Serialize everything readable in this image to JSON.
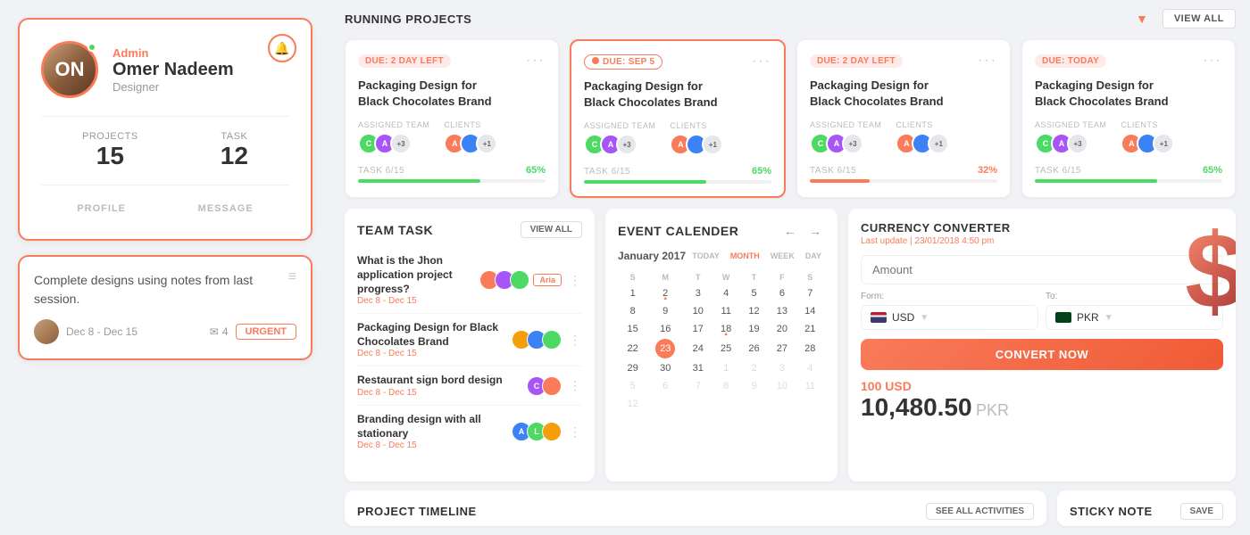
{
  "sidebar": {
    "profile": {
      "role": "Admin",
      "name": "Omer Nadeem",
      "title": "Designer",
      "projects_label": "Projects",
      "projects_count": "15",
      "task_label": "Task",
      "task_count": "12",
      "profile_btn": "PROFILE",
      "message_btn": "MESSAGE"
    },
    "task_card": {
      "text": "Complete designs using notes from last session.",
      "date": "Dec 8 - Dec 15",
      "messages": "4",
      "urgent_label": "URGENT"
    }
  },
  "running_projects": {
    "title": "RUNNING PROJECTS",
    "view_all": "VIEW ALL",
    "cards": [
      {
        "due": "DUE: 2 DAY LEFT",
        "due_type": "left",
        "name": "Packaging Design for Black Chocolates Brand",
        "task_label": "TASK 6/15",
        "progress": 65,
        "progress_type": "green",
        "active": false
      },
      {
        "due": "DUE: SEP 5",
        "due_type": "sep",
        "name": "Packaging Design for Black Chocolates Brand",
        "task_label": "TASK 6/15",
        "progress": 65,
        "progress_type": "green",
        "active": true
      },
      {
        "due": "DUE: 2 DAY LEFT",
        "due_type": "left",
        "name": "Packaging Design for Black Chocolates Brand",
        "task_label": "TASK 6/15",
        "progress": 32,
        "progress_type": "orange",
        "active": false
      },
      {
        "due": "DUE: TODAY",
        "due_type": "today",
        "name": "Packaging Design for Black Chocolates Brand",
        "task_label": "TASK 6/15",
        "progress": 65,
        "progress_type": "green",
        "active": false
      }
    ]
  },
  "team_task": {
    "title": "TEAM TASK",
    "view_all": "VIEW ALL",
    "tasks": [
      {
        "name": "What is the Jhon application project progress?",
        "date": "Dec 8 - Dec 15",
        "has_aria": true
      },
      {
        "name": "Packaging Design for Black Chocolates Brand",
        "date": "Dec 8 - Dec 15",
        "has_aria": false
      },
      {
        "name": "Restaurant sign bord design",
        "date": "Dec 8 - Dec 15",
        "has_aria": false
      },
      {
        "name": "Branding design with all stationary",
        "date": "Dec 8 - Dec 15",
        "has_aria": false
      }
    ]
  },
  "event_calendar": {
    "title": "EVENT CALENDER",
    "month_year": "January 2017",
    "today_btn": "TODAY",
    "month_btn": "MONTH",
    "week_btn": "WEEK",
    "day_btn": "DAY",
    "days": [
      "1",
      "2",
      "3",
      "4",
      "5",
      "6",
      "7",
      "8",
      "9",
      "10",
      "11",
      "12",
      "13",
      "14",
      "15",
      "16",
      "17",
      "18",
      "19",
      "20",
      "21",
      "22",
      "23",
      "24",
      "25",
      "26",
      "27",
      "28",
      "29",
      "30",
      "31"
    ],
    "weekdays": [
      "S",
      "M",
      "T",
      "W",
      "T",
      "F",
      "S"
    ]
  },
  "currency_converter": {
    "title": "CURRENCY CONVERTER",
    "last_update": "Last update | 23/01/2018 4:50 pm",
    "amount_placeholder": "Amount",
    "from_label": "Form:",
    "to_label": "To:",
    "from_currency": "USD",
    "to_currency": "PKR",
    "convert_btn": "CONVERT NOW",
    "result_from": "100 USD",
    "result_value": "10,480.50",
    "result_currency": "PKR"
  },
  "project_timeline": {
    "title": "PROJECT TIMELINE",
    "see_all": "SEE ALL ACTIVITIES"
  },
  "sticky_note": {
    "title": "STICKY NOTE",
    "save_btn": "SAVE"
  }
}
